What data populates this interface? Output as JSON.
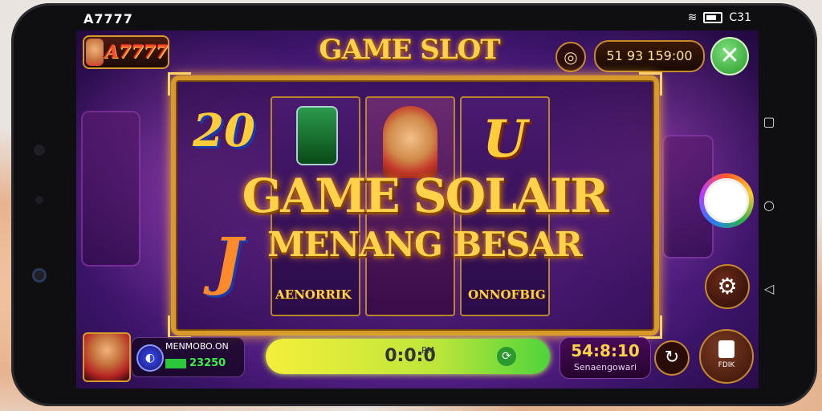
{
  "status_bar": {
    "carrier": "A7777",
    "time": "C31",
    "wifi_icon": "wifi-icon",
    "battery_icon": "battery-icon"
  },
  "game": {
    "logo_text": "A7777",
    "title": "GAME SLOT",
    "balance": "51 93 159:00",
    "close_symbol": "✕",
    "banner_main": "GAME SOLAIR",
    "banner_sub": "MENANG BESAR",
    "reel_labels": [
      "AENORRIK",
      "ONNOFBIG"
    ],
    "reel_symbols": [
      "20",
      "U",
      "J"
    ],
    "player_name": "MENMOBO.ON",
    "player_score": "23250",
    "spin_time": "0:0:0",
    "spin_sub": "PM",
    "win_value": "54:8:10",
    "win_label": "Senaengowari",
    "book_label": "FDIK"
  },
  "colors": {
    "accent_gold": "#ffd24a",
    "spin_green": "#4ed43a",
    "close_green": "#2a9a2e",
    "bg_purple": "#6a2aa0"
  },
  "icons": [
    "camera-shutter-icon",
    "gear-icon",
    "refresh-icon",
    "book-icon",
    "close-icon",
    "audio-icon"
  ]
}
